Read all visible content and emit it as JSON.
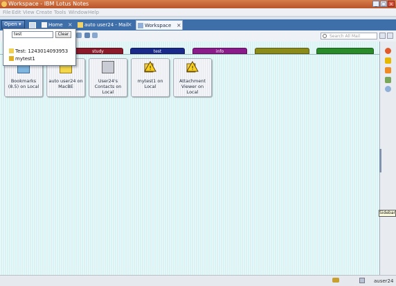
{
  "window": {
    "title": "Workspace - IBM Lotus Notes"
  },
  "menu": [
    "File",
    "Edit",
    "View",
    "Create",
    "Tools",
    "Window",
    "Help"
  ],
  "open_button": {
    "label": "Open"
  },
  "tabs": [
    {
      "label": "Home"
    },
    {
      "label": "auto user24 - Mail"
    },
    {
      "label": "Workspace"
    }
  ],
  "search": {
    "placeholder": "Search All Mail"
  },
  "open_popup": {
    "input_value": "test",
    "clear_label": "Clear",
    "items": [
      {
        "label": "Test: 1243014093953"
      },
      {
        "label": "mytest1"
      }
    ]
  },
  "workspace_tabs": [
    {
      "label": "",
      "color": "#8b1a2a"
    },
    {
      "label": "study",
      "color": "#8b1a2a"
    },
    {
      "label": "test",
      "color": "#1a2a8b"
    },
    {
      "label": "info",
      "color": "#8b1a8b"
    },
    {
      "label": "",
      "color": "#8b8b1a"
    },
    {
      "label": "",
      "color": "#2a8b2a"
    }
  ],
  "tiles": [
    {
      "label": "Bookmarks (8.5) on Local",
      "icon": "bookmarks-icon"
    },
    {
      "label": "auto user24 on MacBE",
      "icon": "mail-db-icon"
    },
    {
      "label": "User24's Contacts on Local",
      "icon": "contacts-icon"
    },
    {
      "label": "mytest1 on Local",
      "icon": "warning-db-icon"
    },
    {
      "label": "Attachment Viewer on Local",
      "icon": "warning-db-icon"
    }
  ],
  "sidebar": {
    "tooltip": "Sidebar"
  },
  "status": {
    "user": "auser24"
  }
}
